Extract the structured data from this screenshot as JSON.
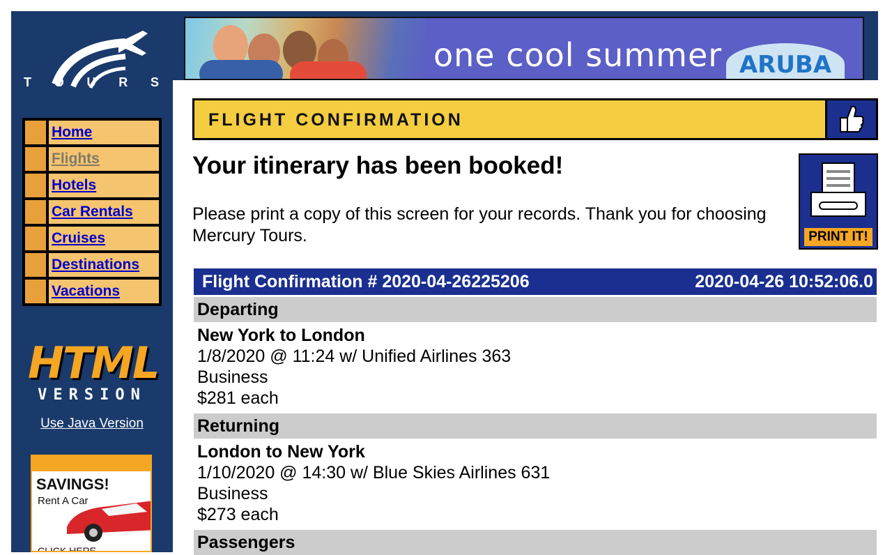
{
  "logo": {
    "letters": [
      "T",
      "O",
      "U",
      "R",
      "S"
    ]
  },
  "banner": {
    "text": "one cool summer",
    "brand": "ARUBA"
  },
  "nav": {
    "items": [
      {
        "label": "Home",
        "visited": false
      },
      {
        "label": "Flights",
        "visited": true
      },
      {
        "label": "Hotels",
        "visited": false
      },
      {
        "label": "Car Rentals",
        "visited": false
      },
      {
        "label": "Cruises",
        "visited": false
      },
      {
        "label": "Destinations",
        "visited": false
      },
      {
        "label": "Vacations",
        "visited": false
      }
    ]
  },
  "side": {
    "html_word": "HTML",
    "version_word": "VERSION",
    "java_link": "Use Java Version"
  },
  "savings": {
    "title": "SAVINGS!",
    "subtitle": "Rent A Car",
    "cta": "CLICK HERE"
  },
  "section": {
    "title": "FLIGHT CONFIRMATION"
  },
  "headline": "Your itinerary has been booked!",
  "message": "Please print a copy of this screen for your records. Thank you for choosing Mercury Tours.",
  "print_button": {
    "label": "PRINT IT!"
  },
  "confirmation": {
    "title": "Flight Confirmation # 2020-04-26225206",
    "timestamp": "2020-04-26 10:52:06.0"
  },
  "departing": {
    "label": "Departing",
    "route": "New York to London",
    "details": "1/8/2020 @ 11:24 w/ Unified Airlines 363",
    "class": "Business",
    "price": "$281 each"
  },
  "returning": {
    "label": "Returning",
    "route": "London to New York",
    "details": "1/10/2020 @ 14:30 w/ Blue Skies Airlines 631",
    "class": "Business",
    "price": "$273 each"
  },
  "passengers": {
    "label": "Passengers"
  },
  "colors": {
    "sidebar": "#1a3a6b",
    "header_yellow": "#f4cd41",
    "confirmation_bar": "#1a2f8f",
    "nav_orange": "#e8a13a",
    "nav_bg": "#f5c46e"
  }
}
